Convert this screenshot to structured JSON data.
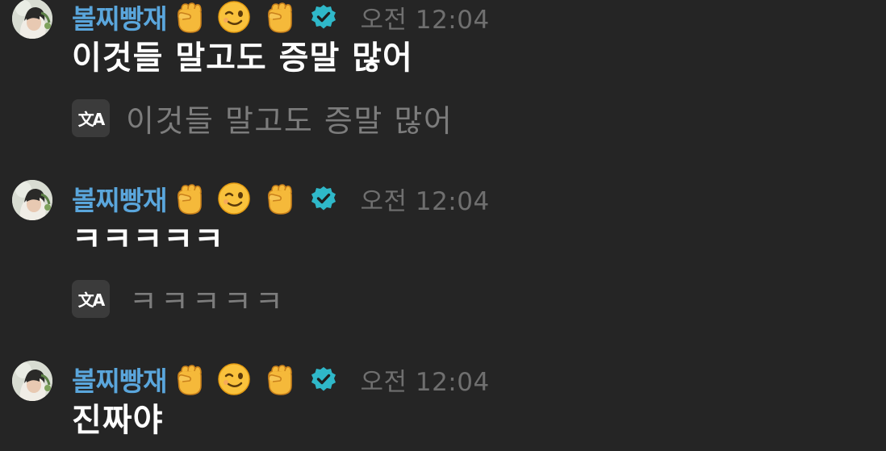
{
  "messages": [
    {
      "username": "볼찌빵재",
      "timestamp": "오전 12:04",
      "text": "이것들 말고도 증말 많어",
      "translation": "이것들 말고도 증말 많어",
      "name_emojis": [
        "raised-fist-emoji",
        "winking-face-emoji",
        "raised-fist-emoji"
      ]
    },
    {
      "username": "볼찌빵재",
      "timestamp": "오전 12:04",
      "text": "ㅋㅋㅋㅋㅋ",
      "translation": "ㅋㅋㅋㅋㅋ",
      "name_emojis": [
        "raised-fist-emoji",
        "winking-face-emoji",
        "raised-fist-emoji"
      ]
    },
    {
      "username": "볼찌빵재",
      "timestamp": "오전 12:04",
      "text": "진짜야",
      "name_emojis": [
        "raised-fist-emoji",
        "winking-face-emoji",
        "raised-fist-emoji"
      ]
    }
  ],
  "translate_icon_glyph": "文A",
  "colors": {
    "background": "#252525",
    "username": "#5aa6dc",
    "verified_badge": "#2fb8c9",
    "timestamp": "#6f6f6f",
    "message_text": "#ffffff",
    "translation_text": "#7c7c7c"
  }
}
